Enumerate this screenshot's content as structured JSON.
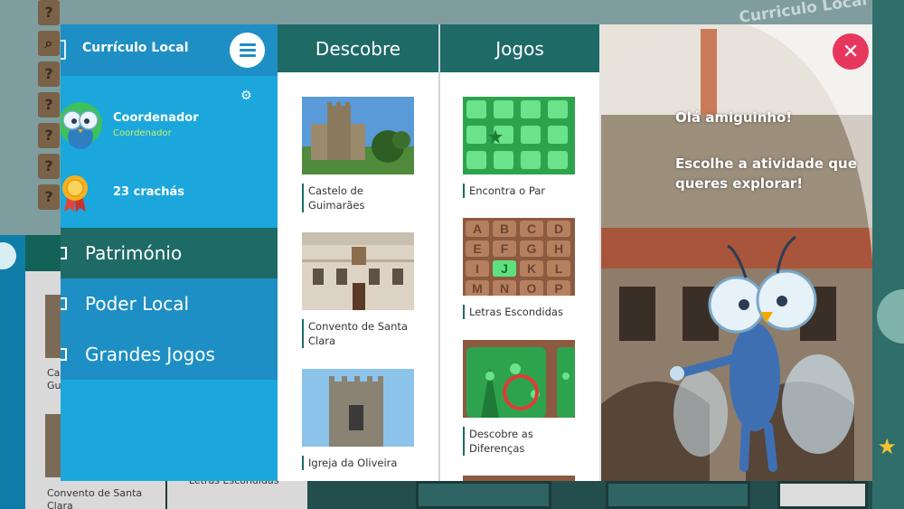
{
  "background": {
    "watermark": "Curriculo Local",
    "question_buttons": [
      "?",
      "?",
      "?",
      "?",
      "?",
      "?",
      "?"
    ],
    "col1_labels": [
      "Ca",
      "Gu",
      "Convento de Santa",
      "Clara"
    ],
    "col2_label": "Letras Escondidas"
  },
  "sidebar": {
    "title": "Currículo Local",
    "user": {
      "name": "Coordenador",
      "role": "Coordenador"
    },
    "badges": "23 crachás",
    "items": [
      {
        "label": "Património",
        "active": true
      },
      {
        "label": "Poder Local",
        "active": false
      },
      {
        "label": "Grandes Jogos",
        "active": false
      }
    ]
  },
  "columns": {
    "discover": {
      "title": "Descobre",
      "cards": [
        {
          "label": "Castelo de Guimarães"
        },
        {
          "label": "Convento de Santa Clara"
        },
        {
          "label": "Igreja da Oliveira"
        }
      ]
    },
    "games": {
      "title": "Jogos",
      "cards": [
        {
          "label": "Encontra o Par"
        },
        {
          "label": "Letras Escondidas",
          "letters": [
            "A",
            "B",
            "C",
            "D",
            "E",
            "F",
            "G",
            "H",
            "I",
            "J",
            "K",
            "L",
            "M",
            "N",
            "O",
            "P"
          ]
        },
        {
          "label": "Descobre as Diferenças"
        }
      ]
    }
  },
  "hero": {
    "greeting": "Olá amiguinho!",
    "prompt": "Escolhe a atividade que queres explorar!"
  },
  "colors": {
    "teal": "#1e6a67",
    "nav_blue": "#1ba7dc",
    "nav_dark_blue": "#1e8fc4",
    "close_red": "#e8375e",
    "badge_green": "#c9f06b"
  }
}
